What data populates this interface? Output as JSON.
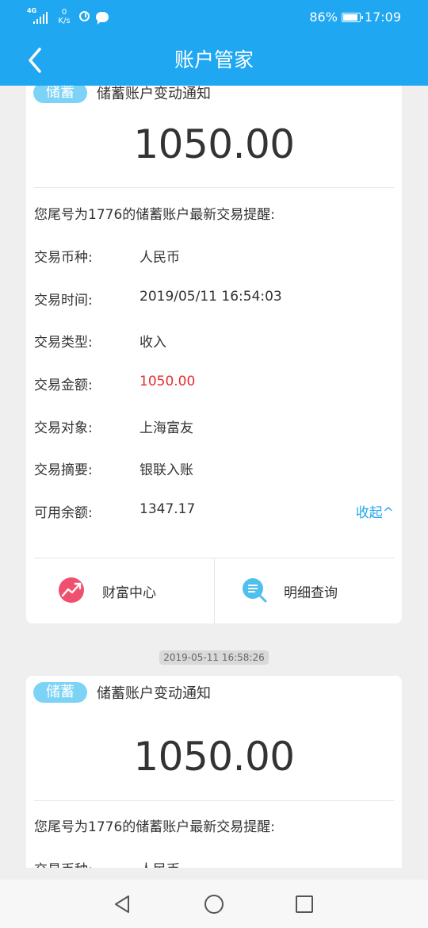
{
  "status_bar": {
    "network_tag": "4G",
    "speed_value": "0",
    "speed_unit": "K/s",
    "battery": "86%",
    "time": "17:09"
  },
  "nav": {
    "title": "账户管家",
    "back_icon": "chevron-left-icon"
  },
  "colors": {
    "primary": "#1fa7f1",
    "badge": "#7dd3f5",
    "amount_highlight": "#e52d2d",
    "wealth_icon": "#f0506e"
  },
  "cards": [
    {
      "badge": "储蓄",
      "title": "储蓄账户变动通知",
      "amount": "1050.00",
      "intro": "您尾号为1776的储蓄账户最新交易提醒:",
      "details": [
        {
          "label": "交易币种:",
          "value": "人民币"
        },
        {
          "label": "交易时间:",
          "value": "2019/05/11 16:54:03"
        },
        {
          "label": "交易类型:",
          "value": "收入"
        },
        {
          "label": "交易金额:",
          "value": "1050.00"
        },
        {
          "label": "交易对象:",
          "value": "上海富友"
        },
        {
          "label": "交易摘要:",
          "value": "银联入账"
        },
        {
          "label": "可用余额:",
          "value": "1347.17"
        }
      ],
      "collapse_label": "收起^",
      "actions": [
        {
          "label": "财富中心",
          "icon": "wealth-chart-icon"
        },
        {
          "label": "明细查询",
          "icon": "search-list-icon"
        }
      ]
    },
    {
      "badge": "储蓄",
      "title": "储蓄账户变动通知",
      "amount": "1050.00",
      "intro": "您尾号为1776的储蓄账户最新交易提醒:",
      "details": [
        {
          "label": "交易币种:",
          "value": "人民币"
        }
      ]
    }
  ],
  "timestamp": "2019-05-11 16:58:26",
  "bottom_nav": {
    "back": "triangle-back-icon",
    "home": "circle-home-icon",
    "recents": "square-recents-icon"
  }
}
